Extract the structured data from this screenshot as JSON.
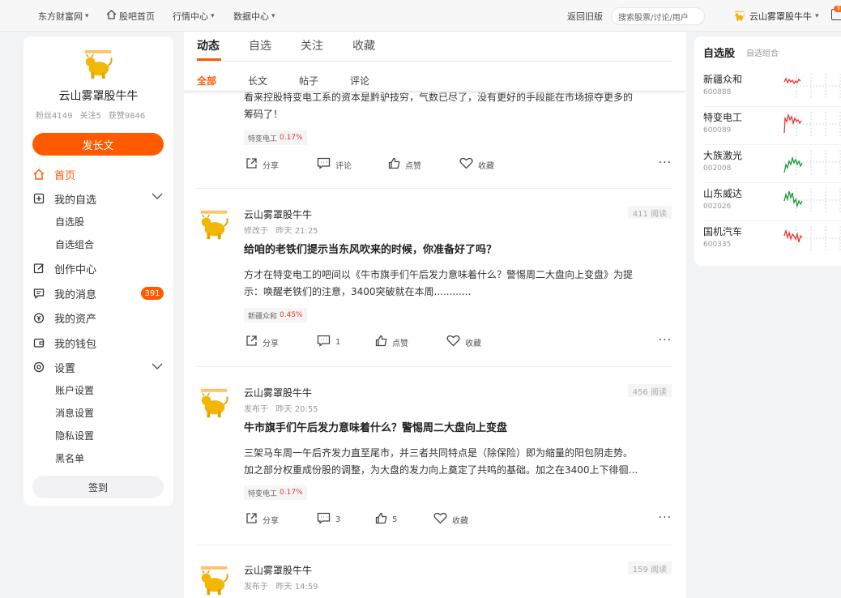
{
  "topbar": {
    "nav": [
      "东方财富网",
      "股吧首页",
      "行情中心",
      "数据中心"
    ],
    "back_old": "返回旧版",
    "search_placeholder": "搜索股票/讨论/用户",
    "username": "云山雾罩股牛牛",
    "notif_count": "9"
  },
  "profile": {
    "name": "云山雾罩股牛牛",
    "fans": "粉丝4149",
    "follows": "关注5",
    "likes": "获赞9846",
    "post_button": "发长文"
  },
  "menu": {
    "home": "首页",
    "my_watch": "我的自选",
    "watch_stocks": "自选股",
    "watch_groups": "自选组合",
    "creator": "创作中心",
    "messages": "我的消息",
    "messages_count": "391",
    "assets": "我的资产",
    "wallet": "我的钱包",
    "settings": "设置",
    "account": "账户设置",
    "message_settings": "消息设置",
    "privacy": "隐私设置",
    "blacklist": "黑名单",
    "signin": "签到"
  },
  "tabs": [
    "动态",
    "自选",
    "关注",
    "收藏"
  ],
  "subtabs": [
    "全部",
    "长文",
    "帖子",
    "评论"
  ],
  "posts": [
    {
      "body1": "看来控股特变电工系的资本是黔驴技穷，气数已尽了，没有更好的手段能在市场掠夺更多的",
      "body2": "筹码了！",
      "stock": "特变电工",
      "change": "0.17%",
      "share": "分享",
      "comment": "评论",
      "like": "点赞",
      "fav": "收藏"
    },
    {
      "author": "云山雾罩股牛牛",
      "action": "修改于",
      "time": "昨天 21:25",
      "reads": "411 阅读",
      "title": "给咱的老铁们提示当东风吹来的时候，你准备好了吗？",
      "body1": "方才在特变电工的吧间以《牛市旗手们午后发力意味着什么？警惕周二大盘向上变盘》为提",
      "body2": "示：唤醒老铁们的注意，3400突破就在本周............",
      "stock": "新疆众和",
      "change": "0.45%",
      "share": "分享",
      "comment": "1",
      "like": "点赞",
      "fav": "收藏"
    },
    {
      "author": "云山雾罩股牛牛",
      "action": "发布于",
      "time": "昨天 20:55",
      "reads": "456 阅读",
      "title": "牛市旗手们午后发力意味着什么？警惕周二大盘向上变盘",
      "body1": "三架马车周一午后齐发力直至尾市，并三者共同特点是（除保险）即为缩量的阳包阴走势。",
      "body2": "加之部分权重成份股的调整，为大盘的发力向上奠定了共鸣的基础。加之在3400上下徘徊…",
      "stock": "特变电工",
      "change": "0.17%",
      "share": "分享",
      "comment": "3",
      "like": "5",
      "fav": "收藏"
    },
    {
      "author": "云山雾罩股牛牛",
      "action": "发布于",
      "time": "昨天 14:59",
      "reads": "159 阅读"
    }
  ],
  "watchlist": {
    "title": "自选股",
    "subtitle": "自选组合",
    "stocks": [
      {
        "name": "新疆众和",
        "code": "600888",
        "trend": "up"
      },
      {
        "name": "特变电工",
        "code": "600089",
        "trend": "up"
      },
      {
        "name": "大族激光",
        "code": "002008",
        "trend": "down"
      },
      {
        "name": "山东威达",
        "code": "002026",
        "trend": "down"
      },
      {
        "name": "国机汽车",
        "code": "600335",
        "trend": "up"
      }
    ]
  },
  "colors": {
    "accent": "#ff5a00",
    "up": "#e33333",
    "down": "#1a9a3a"
  }
}
